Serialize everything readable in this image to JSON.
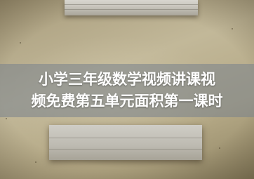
{
  "caption": {
    "line1": "小学三年级数学视频讲课视",
    "line2": "频免费第五单元面积第一课时"
  }
}
